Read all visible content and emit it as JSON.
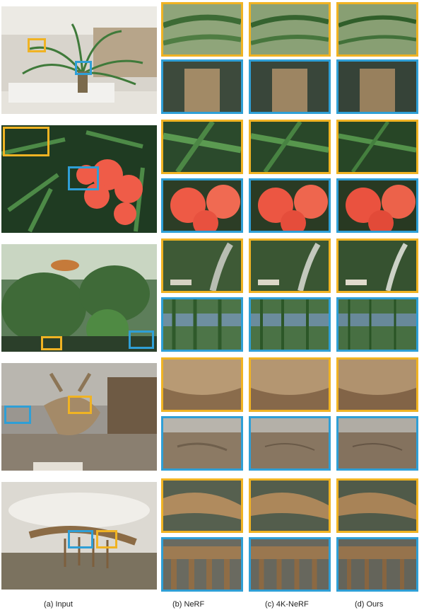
{
  "captions": {
    "input": "(a) Input",
    "nerf": "(b)  NeRF",
    "k4nerf": "(c) 4K-NeRF",
    "ours": "(d) Ours"
  },
  "colors": {
    "yellow_box": "#f0b323",
    "blue_box": "#2f9fd6"
  },
  "scenes": [
    {
      "name": "plant-atrium"
    },
    {
      "name": "red-flowers"
    },
    {
      "name": "greenhouse"
    },
    {
      "name": "triceratops"
    },
    {
      "name": "dinosaur-skeleton"
    }
  ]
}
